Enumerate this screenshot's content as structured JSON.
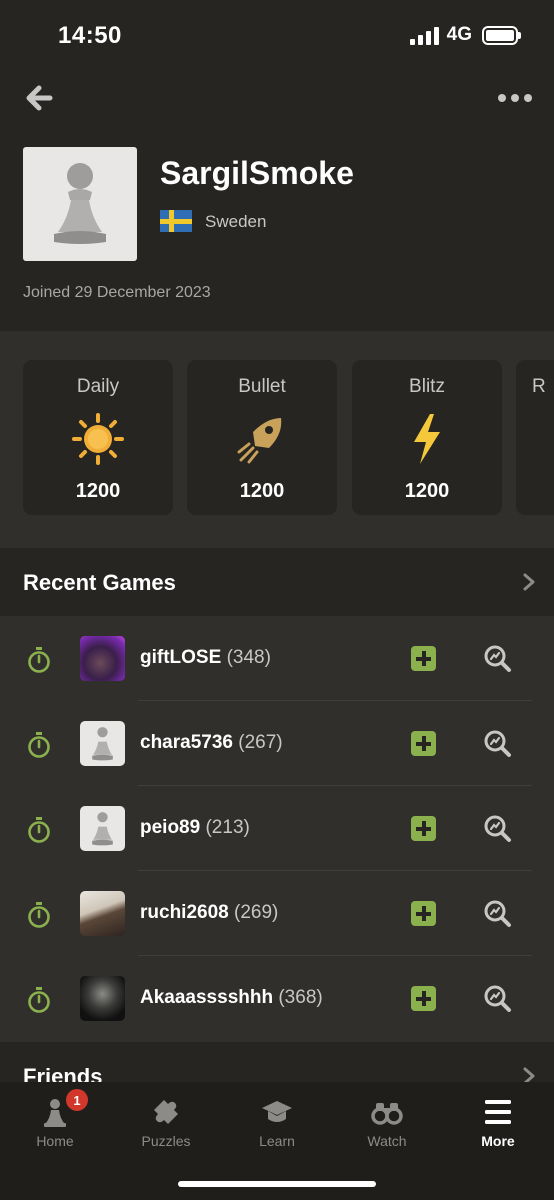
{
  "status": {
    "time": "14:50",
    "network": "4G"
  },
  "profile": {
    "username": "SargilSmoke",
    "country": "Sweden",
    "joined": "Joined 29 December 2023"
  },
  "ratings": [
    {
      "label": "Daily",
      "value": "1200",
      "icon": "sun-icon",
      "color": "#f0ae37"
    },
    {
      "label": "Bullet",
      "value": "1200",
      "icon": "bullet-icon",
      "color": "#c8a15a"
    },
    {
      "label": "Blitz",
      "value": "1200",
      "icon": "lightning-icon",
      "color": "#f5c73b"
    },
    {
      "label": "R",
      "value": "",
      "icon": "rapid-icon",
      "color": "#8bb04e"
    }
  ],
  "recent_games": {
    "title": "Recent Games",
    "games": [
      {
        "name": "giftLOSE",
        "rating": "(348)"
      },
      {
        "name": "chara5736",
        "rating": "(267)"
      },
      {
        "name": "peio89",
        "rating": "(213)"
      },
      {
        "name": "ruchi2608",
        "rating": "(269)"
      },
      {
        "name": "Akaaasssshhh",
        "rating": "(368)"
      }
    ]
  },
  "friends": {
    "title": "Friends"
  },
  "nav": {
    "home": "Home",
    "home_badge": "1",
    "puzzles": "Puzzles",
    "learn": "Learn",
    "watch": "Watch",
    "more": "More"
  },
  "colors": {
    "accent_green": "#8bb04e",
    "badge_red": "#d1372b",
    "background": "#262522",
    "panel": "#312f2b"
  }
}
